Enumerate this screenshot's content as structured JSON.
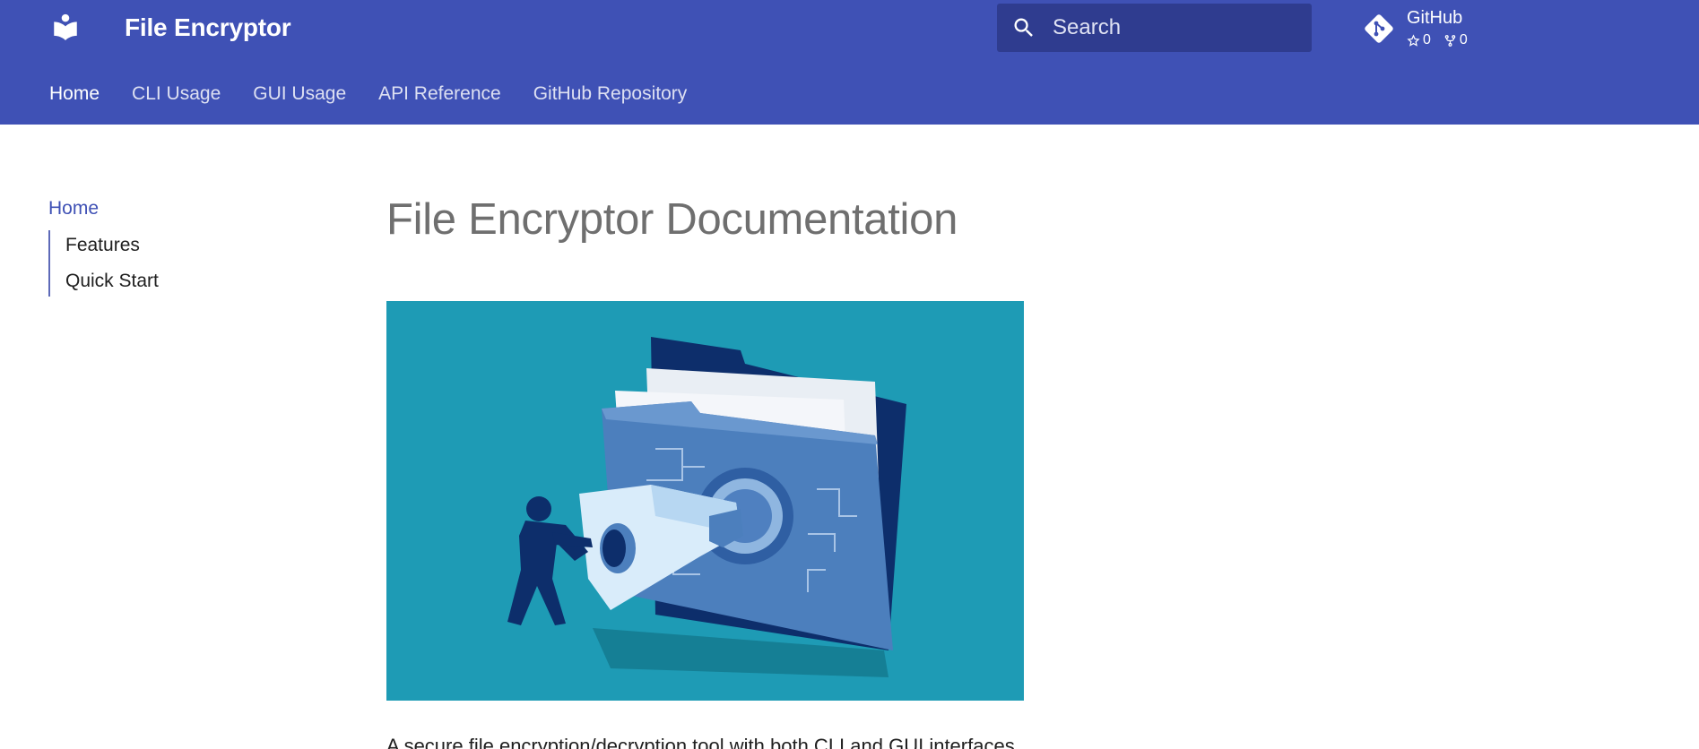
{
  "header": {
    "site_title": "File Encryptor",
    "logo_icon": "book-reader-icon",
    "search": {
      "placeholder": "Search",
      "icon": "search-icon"
    },
    "repo": {
      "name": "GitHub",
      "icon": "git-icon",
      "stars": "0",
      "forks": "0"
    },
    "accent_color": "#3f51b5"
  },
  "tabs": [
    {
      "label": "Home",
      "active": true
    },
    {
      "label": "CLI Usage",
      "active": false
    },
    {
      "label": "GUI Usage",
      "active": false
    },
    {
      "label": "API Reference",
      "active": false
    },
    {
      "label": "GitHub Repository",
      "active": false
    }
  ],
  "sidebar": {
    "home_label": "Home",
    "toc": [
      {
        "label": "Features"
      },
      {
        "label": "Quick Start"
      }
    ]
  },
  "content": {
    "title": "File Encryptor Documentation",
    "hero_image": "folder-key-encryption-illustration",
    "intro_text": "A secure file encryption/decryption tool with both CLI and GUI interfaces."
  }
}
